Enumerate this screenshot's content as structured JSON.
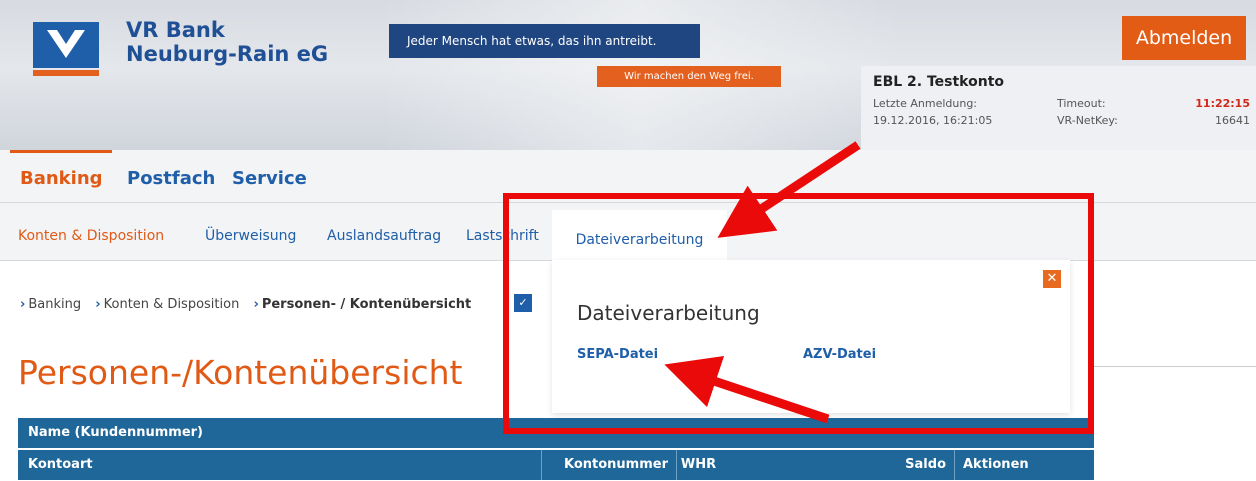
{
  "header": {
    "bank_name_line1": "VR Bank",
    "bank_name_line2": "Neuburg-Rain eG",
    "slogan": "Jeder Mensch hat etwas, das ihn antreibt.",
    "slogan_sub": "Wir machen den Weg frei.",
    "logout_label": "Abmelden"
  },
  "account": {
    "name": "EBL 2. Testkonto",
    "last_login_label": "Letzte Anmeldung:",
    "last_login_value": "19.12.2016, 16:21:05",
    "timeout_label": "Timeout:",
    "timeout_value": "11:22:15",
    "netkey_label": "VR-NetKey:",
    "netkey_value": "16641"
  },
  "main_nav": {
    "items": [
      "Banking",
      "Postfach",
      "Service"
    ],
    "active": "Banking"
  },
  "sub_nav": {
    "items": [
      "Konten & Disposition",
      "Überweisung",
      "Auslandsauftrag",
      "Lastschrift"
    ],
    "active_tab": "Dateiverarbeitung"
  },
  "breadcrumb": {
    "items": [
      "Banking",
      "Konten & Disposition",
      "Personen- / Kontenübersicht"
    ]
  },
  "page_title": "Personen-/Kontenübersicht",
  "table": {
    "header_row1": "Name (Kundennummer)",
    "columns": [
      "Kontoart",
      "Kontonummer",
      "WHR",
      "Saldo",
      "Aktionen"
    ]
  },
  "popup": {
    "title": "Dateiverarbeitung",
    "links": [
      "SEPA-Datei",
      "AZV-Datei"
    ]
  },
  "colors": {
    "brand_blue": "#1f5ea8",
    "brand_orange": "#e05a15",
    "annotation_red": "#ea0a0a",
    "table_header": "#1f6699"
  }
}
